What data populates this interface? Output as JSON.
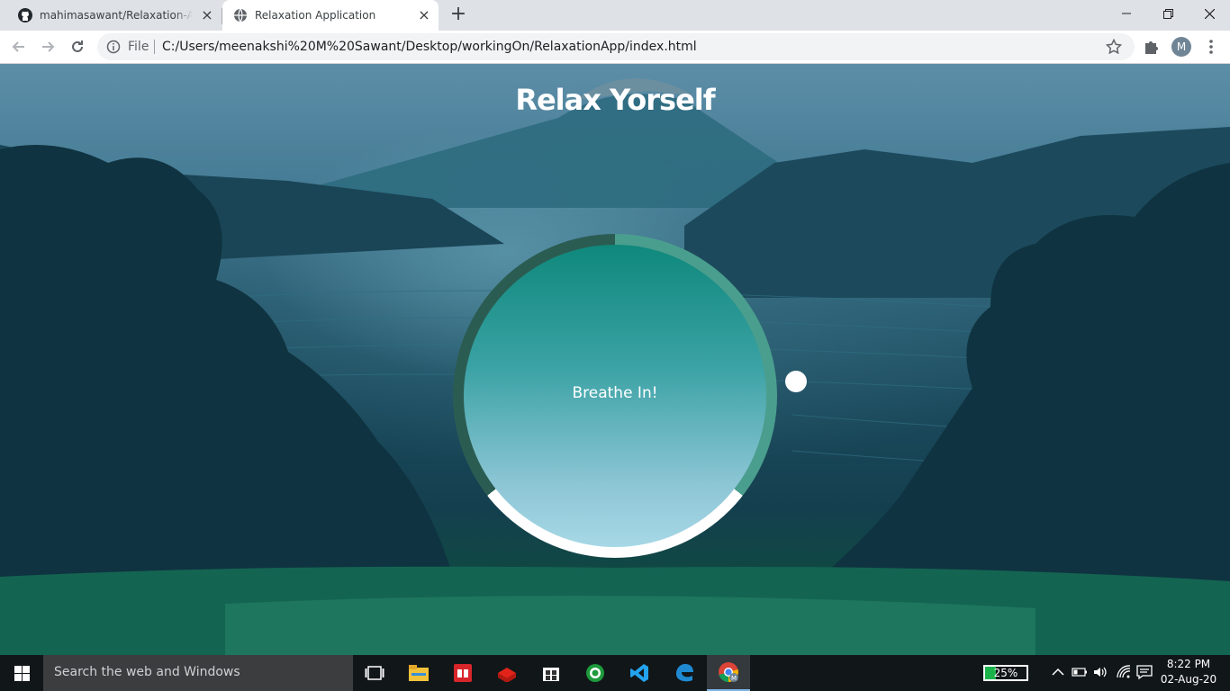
{
  "browser": {
    "tabs": [
      {
        "label": "mahimasawant/Relaxation-App: C",
        "icon": "github-icon",
        "active": false
      },
      {
        "label": "Relaxation Application",
        "icon": "globe-icon",
        "active": true
      }
    ],
    "new_tab_icon": "plus-icon",
    "address_bar": {
      "scheme_label": "File",
      "url": "C:/Users/meenakshi%20M%20Sawant/Desktop/workingOn/RelaxationApp/index.html"
    },
    "profile_initial": "M"
  },
  "app": {
    "title": "Relax Yorself",
    "breath_text": "Breathe In!",
    "colors": {
      "ring_breathe_in": "#4a9e8e",
      "ring_hold": "#ffffff",
      "ring_breathe_out": "#2b5c52",
      "inner_top": "#0f887c",
      "inner_bottom": "#a7d8e6"
    }
  },
  "taskbar": {
    "search_placeholder": "Search the web and Windows",
    "apps": [
      "task-view-icon",
      "file-explorer-icon",
      "reader-icon",
      "lego-icon",
      "store-icon",
      "icon-app-icon",
      "vscode-icon",
      "edge-icon",
      "chrome-icon"
    ],
    "battery_percent": "25%",
    "time": "8:22 PM",
    "date": "02-Aug-20"
  }
}
